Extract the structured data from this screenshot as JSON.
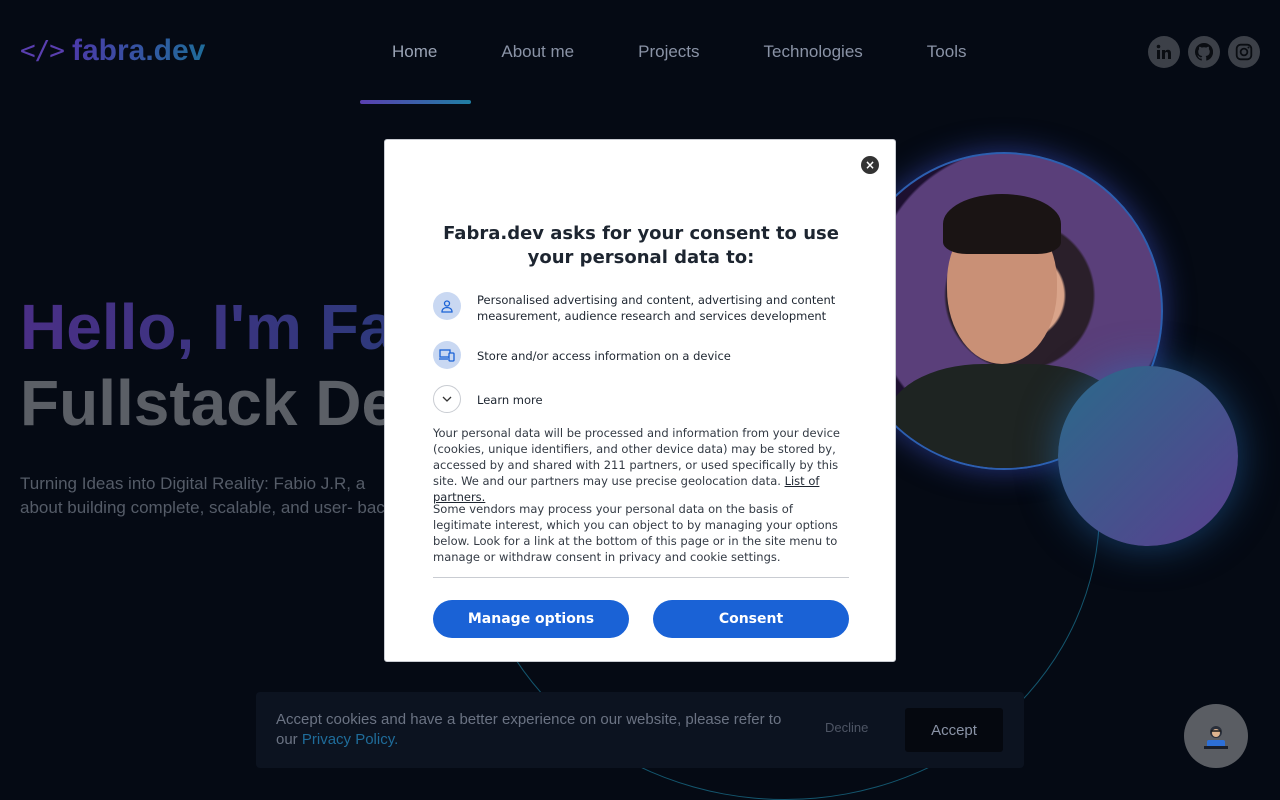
{
  "header": {
    "logo_code": "</>",
    "logo_text": "fabra.dev",
    "nav": [
      {
        "label": "Home"
      },
      {
        "label": "About me"
      },
      {
        "label": "Projects"
      },
      {
        "label": "Technologies"
      },
      {
        "label": "Tools"
      }
    ],
    "socials": [
      "linkedin-icon",
      "github-icon",
      "instagram-icon"
    ]
  },
  "hero": {
    "hello": "Hello, I'm Fab",
    "role": "Fullstack De",
    "description": "Turning Ideas into Digital Reality: Fabio J.R, a about building complete, scalable, and user- back."
  },
  "consent": {
    "close": "×",
    "title": "Fabra.dev asks for your consent to use your personal data to:",
    "purposes": [
      {
        "icon": "person-icon",
        "text": "Personalised advertising and content, advertising and content measurement, audience research and services development"
      },
      {
        "icon": "devices-icon",
        "text": "Store and/or access information on a device"
      }
    ],
    "learn_more": "Learn more",
    "para1": "Your personal data will be processed and information from your device (cookies, unique identifiers, and other device data) may be stored by, accessed by and shared with 211 partners, or used specifically by this site. We and our partners may use precise geolocation data.",
    "partners_link": "List of partners.",
    "para2": "Some vendors may process your personal data on the basis of legitimate interest, which you can object to by managing your options below. Look for a link at the bottom of this page or in the site menu to manage or withdraw consent in privacy and cookie settings.",
    "manage_label": "Manage options",
    "consent_label": "Consent"
  },
  "cookie_bar": {
    "text": "Accept cookies and have a better experience on our website, please refer to our",
    "link": "Privacy Policy.",
    "decline": "Decline",
    "accept": "Accept"
  },
  "colors": {
    "accent": "#1a62d6",
    "brand_purple": "#5a3fb0",
    "brand_teal": "#1f6c9a"
  }
}
